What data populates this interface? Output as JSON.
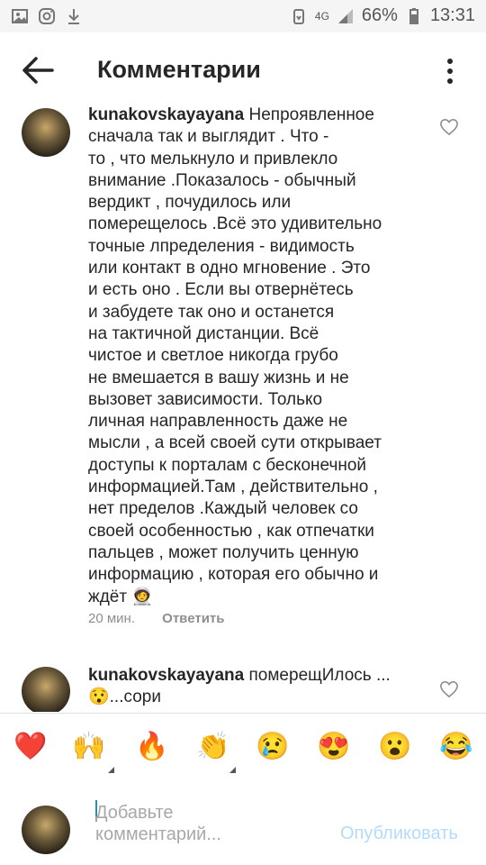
{
  "status_bar": {
    "network": "4G",
    "battery": "66%",
    "time": "13:31"
  },
  "header": {
    "title": "Комментарии",
    "back_icon": "arrow-left-icon",
    "more_icon": "vertical-dots-icon"
  },
  "comments": [
    {
      "username": "kunakovskayayana",
      "lines": [
        "Непроявленное",
        "сначала так и выглядит . Что -",
        "то , что мелькнуло и привлекло",
        "внимание .Показалось - обычный",
        "вердикт , почудилось или",
        "померещелось .Всё это удивительно",
        "точные лпределения - видимость",
        "или контакт в одно мгновение . Это",
        "и есть оно . Если вы отвернётесь",
        "и забудете так оно и останется",
        "на тактичной дистанции. Всё",
        "чистое и светлое никогда грубо",
        "не вмешается в вашу жизнь и не",
        "вызовет зависимости. Только",
        "личная направленность даже не",
        "мысли , а всей своей сути открывает",
        "доступы к порталам с бесконечной",
        "информацией.Там , действительно ,",
        "нет пределов .Каждый человек со",
        "своей особенностью , как отпечатки",
        "пальцев , может получить ценную",
        "информацию , которая его обычно и",
        "ждёт 🧑‍🚀"
      ],
      "time": "20 мин.",
      "reply_label": "Ответить"
    },
    {
      "username": "kunakovskayayana",
      "lines": [
        "померещИлось ...",
        "😯...сори"
      ]
    }
  ],
  "emoji_bar": [
    "❤️",
    "🙌",
    "🔥",
    "👏",
    "😢",
    "😍",
    "😮",
    "😂"
  ],
  "composer": {
    "placeholder_line1": "Добавьте",
    "placeholder_line2": "комментарий...",
    "publish_label": "Опубликовать"
  }
}
